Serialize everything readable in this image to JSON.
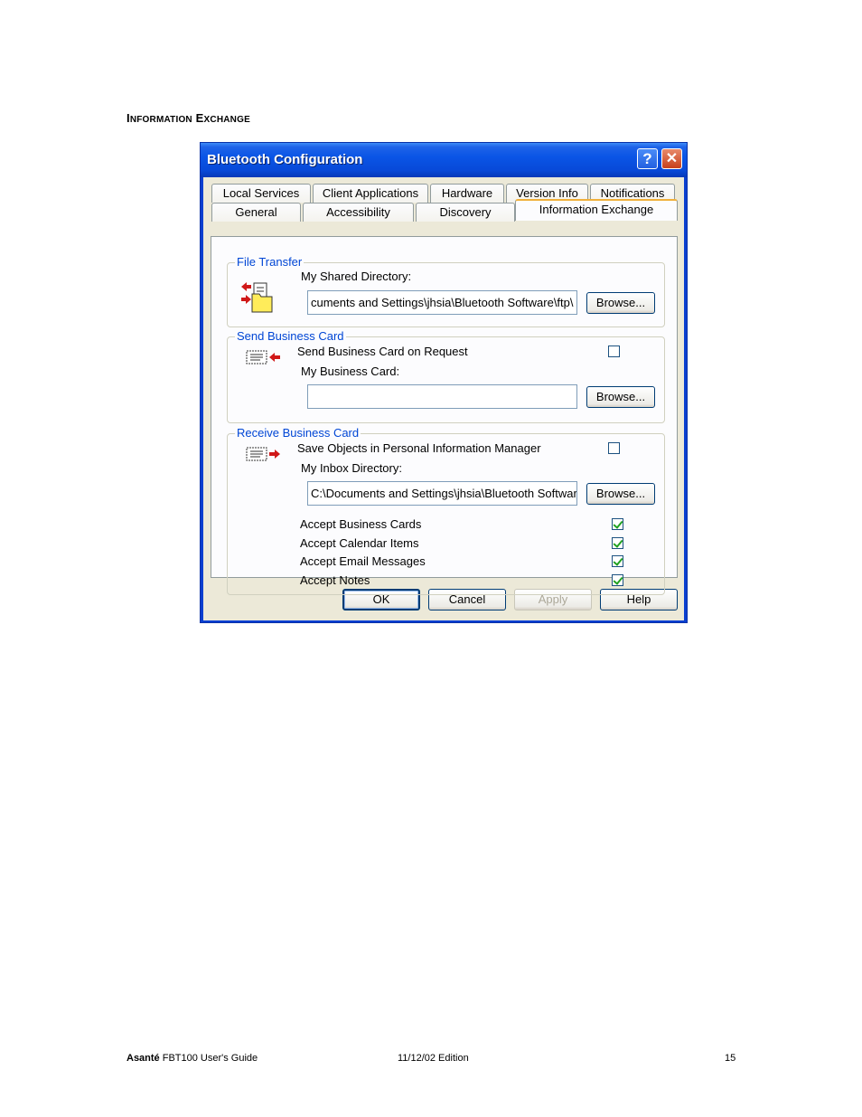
{
  "heading": {
    "first_big": "I",
    "first_small": "NFORMATION",
    "second_big": "E",
    "second_small": "XCHANGE"
  },
  "dialog": {
    "title": "Bluetooth Configuration",
    "help_glyph": "?",
    "close_glyph": "✕",
    "tabs_row1": [
      "Local Services",
      "Client Applications",
      "Hardware",
      "Version Info",
      "Notifications"
    ],
    "tabs_row2": [
      "General",
      "Accessibility",
      "Discovery"
    ],
    "active_tab": "Information Exchange",
    "file_transfer": {
      "legend": "File Transfer",
      "label": "My Shared Directory:",
      "value": "cuments and Settings\\jhsia\\Bluetooth Software\\ftp\\",
      "browse": "Browse..."
    },
    "send_card": {
      "legend": "Send Business Card",
      "option": "Send Business Card on Request",
      "option_checked": false,
      "label": "My Business Card:",
      "value": "",
      "browse": "Browse..."
    },
    "receive_card": {
      "legend": "Receive Business Card",
      "option": "Save Objects in Personal Information Manager",
      "option_checked": false,
      "label": "My Inbox Directory:",
      "value": "C:\\Documents and Settings\\jhsia\\Bluetooth Softwar",
      "browse": "Browse...",
      "accept": [
        {
          "label": "Accept Business Cards",
          "checked": true
        },
        {
          "label": "Accept Calendar Items",
          "checked": true
        },
        {
          "label": "Accept Email Messages",
          "checked": true
        },
        {
          "label": "Accept Notes",
          "checked": true
        }
      ]
    },
    "buttons": {
      "ok": "OK",
      "cancel": "Cancel",
      "apply": "Apply",
      "help": "Help"
    }
  },
  "footer": {
    "brand": "Asanté",
    "guide": " FBT100 User's Guide",
    "edition": "11/12/02 Edition",
    "page": "15"
  }
}
